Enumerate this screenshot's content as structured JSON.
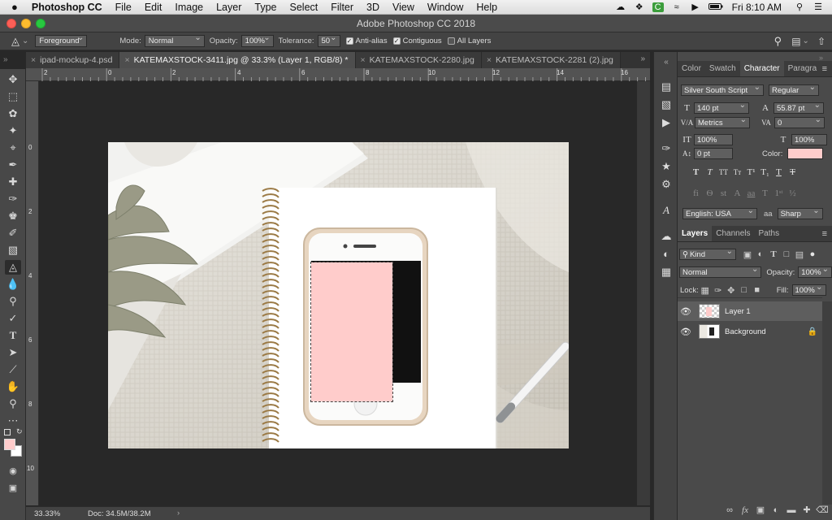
{
  "menubar": {
    "apple": "",
    "app": "Photoshop CC",
    "items": [
      "File",
      "Edit",
      "Image",
      "Layer",
      "Type",
      "Select",
      "Filter",
      "3D",
      "View",
      "Window",
      "Help"
    ],
    "clock": "Fri 8:10 AM",
    "status_icons": [
      "creative-cloud-icon",
      "dropbox-icon",
      "green-app-icon",
      "wifi-icon",
      "volume-icon",
      "battery-icon",
      "spotlight-icon",
      "notifications-icon"
    ]
  },
  "window": {
    "title": "Adobe Photoshop CC 2018"
  },
  "options": {
    "fill_source": "Foreground",
    "mode_label": "Mode:",
    "mode_value": "Normal",
    "opacity_label": "Opacity:",
    "opacity_value": "100%",
    "tolerance_label": "Tolerance:",
    "tolerance_value": "50",
    "anti_alias": "Anti-alias",
    "contiguous": "Contiguous",
    "all_layers": "All Layers"
  },
  "tabs": [
    {
      "label": "ipad-mockup-4.psd",
      "active": false
    },
    {
      "label": "KATEMAXSTOCK-3411.jpg @ 33.3% (Layer 1, RGB/8) *",
      "active": true
    },
    {
      "label": "KATEMAXSTOCK-2280.jpg",
      "active": false
    },
    {
      "label": "KATEMAXSTOCK-2281 (2).jpg",
      "active": false
    }
  ],
  "ruler": {
    "h": [
      "2",
      "0",
      "2",
      "4",
      "6",
      "8",
      "10",
      "12",
      "14",
      "16"
    ],
    "v": [
      "0",
      "2",
      "4",
      "6",
      "8",
      "10",
      "12"
    ]
  },
  "status": {
    "zoom": "33.33%",
    "doc": "Doc: 34.5M/38.2M"
  },
  "character": {
    "tabs": [
      "Color",
      "Swatch",
      "Character",
      "Paragra"
    ],
    "font_family": "Silver South Script",
    "font_style": "Regular",
    "size": "140 pt",
    "leading": "55.87 pt",
    "kerning": "Metrics",
    "tracking": "0",
    "vscale": "100%",
    "hscale": "100%",
    "baseline": "0 pt",
    "color_label": "Color:",
    "color_value": "#ffcccb",
    "language": "English: USA",
    "aa_label": "aa",
    "antialias": "Sharp"
  },
  "layers": {
    "tabs": [
      "Layers",
      "Channels",
      "Paths"
    ],
    "filter": "Kind",
    "blend": "Normal",
    "opacity_label": "Opacity:",
    "opacity": "100%",
    "lock_label": "Lock:",
    "fill_label": "Fill:",
    "fill": "100%",
    "items": [
      {
        "name": "Layer 1",
        "selected": true,
        "locked": false
      },
      {
        "name": "Background",
        "selected": false,
        "locked": true
      }
    ]
  },
  "colors": {
    "foreground": "#ffcccb",
    "background": "#ffffff",
    "selection_fill": "#ffcccb"
  }
}
